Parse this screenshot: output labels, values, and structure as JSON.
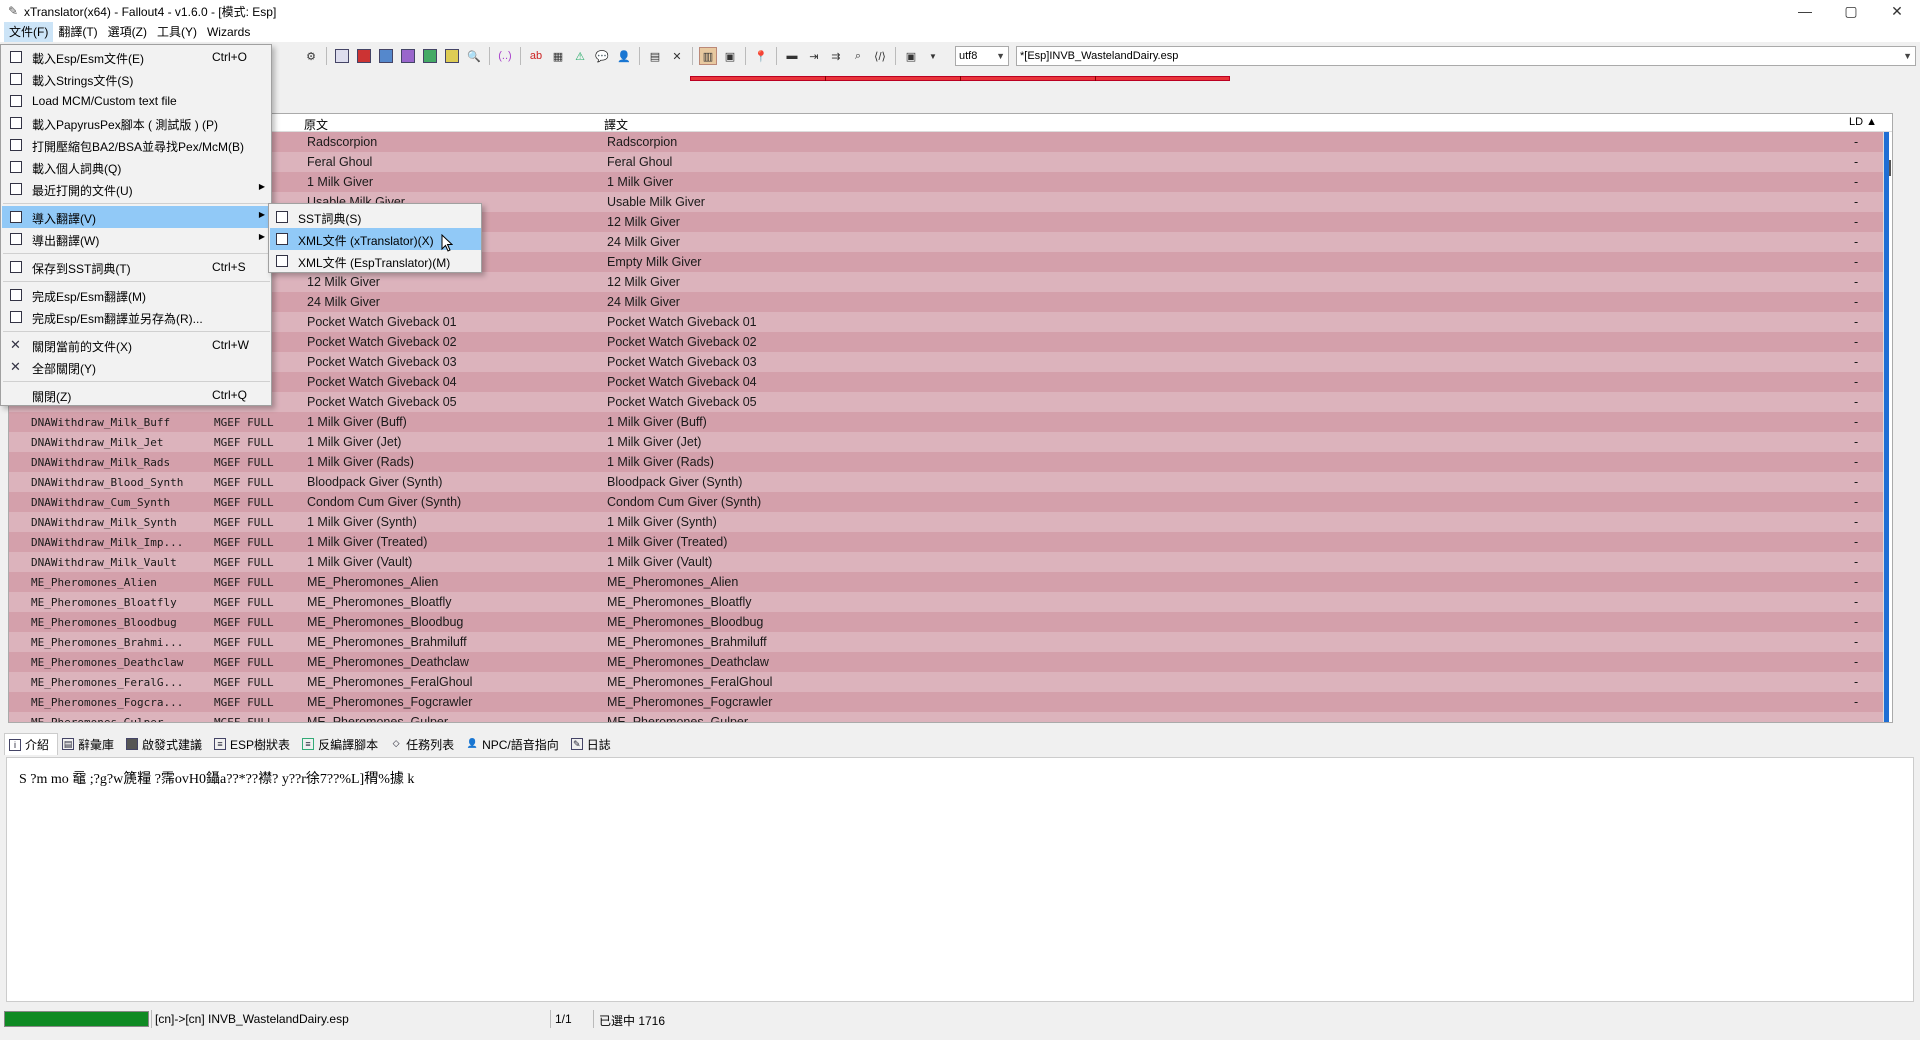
{
  "window": {
    "title": "xTranslator(x64) - Fallout4 - v1.6.0 - [模式: Esp]",
    "controls": [
      "—",
      "▢",
      "✕"
    ]
  },
  "menubar": [
    "文件(F)",
    "翻譯(T)",
    "選項(Z)",
    "工具(Y)",
    "Wizards"
  ],
  "toolbar": {
    "encoding": "utf8",
    "file": "*[Esp]INVB_WastelandDairy.esp"
  },
  "list": {
    "headers": {
      "source": "原文",
      "translation": "譯文",
      "ld": "LD ▲"
    },
    "rows": [
      {
        "id": "",
        "type": "",
        "src": "Radscorpion",
        "tr": "Radscorpion",
        "ld": "-"
      },
      {
        "id": "",
        "type": "",
        "src": "Feral Ghoul",
        "tr": "Feral Ghoul",
        "ld": "-"
      },
      {
        "id": "",
        "type": "",
        "src": "1 Milk Giver",
        "tr": "1 Milk Giver",
        "ld": "-"
      },
      {
        "id": "",
        "type": "",
        "src": "Usable Milk Giver",
        "tr": "Usable Milk Giver",
        "ld": "-"
      },
      {
        "id": "",
        "type": "",
        "src": "",
        "tr": "12 Milk Giver",
        "ld": "-"
      },
      {
        "id": "",
        "type": "",
        "src": "",
        "tr": "24 Milk Giver",
        "ld": "-"
      },
      {
        "id": "",
        "type": "",
        "src": "",
        "tr": "Empty Milk Giver",
        "ld": "-"
      },
      {
        "id": "",
        "type": "",
        "src": "12 Milk Giver",
        "tr": "12 Milk Giver",
        "ld": "-"
      },
      {
        "id": "",
        "type": "",
        "src": "24 Milk Giver",
        "tr": "24 Milk Giver",
        "ld": "-"
      },
      {
        "id": "",
        "type": "",
        "src": "Pocket Watch Giveback 01",
        "tr": "Pocket Watch Giveback 01",
        "ld": "-"
      },
      {
        "id": "",
        "type": "",
        "src": "Pocket Watch Giveback 02",
        "tr": "Pocket Watch Giveback 02",
        "ld": "-"
      },
      {
        "id": "",
        "type": "",
        "src": "Pocket Watch Giveback 03",
        "tr": "Pocket Watch Giveback 03",
        "ld": "-"
      },
      {
        "id": "",
        "type": "",
        "src": "Pocket Watch Giveback 04",
        "tr": "Pocket Watch Giveback 04",
        "ld": "-"
      },
      {
        "id": "",
        "type": "",
        "src": "Pocket Watch Giveback 05",
        "tr": "Pocket Watch Giveback 05",
        "ld": "-"
      },
      {
        "id": "DNAWithdraw_Milk_Buff",
        "type": "MGEF FULL",
        "src": "1 Milk Giver (Buff)",
        "tr": "1 Milk Giver (Buff)",
        "ld": "-"
      },
      {
        "id": "DNAWithdraw_Milk_Jet",
        "type": "MGEF FULL",
        "src": "1 Milk Giver (Jet)",
        "tr": "1 Milk Giver (Jet)",
        "ld": "-"
      },
      {
        "id": "DNAWithdraw_Milk_Rads",
        "type": "MGEF FULL",
        "src": "1 Milk Giver (Rads)",
        "tr": "1 Milk Giver (Rads)",
        "ld": "-"
      },
      {
        "id": "DNAWithdraw_Blood_Synth",
        "type": "MGEF FULL",
        "src": "Bloodpack Giver (Synth)",
        "tr": "Bloodpack Giver (Synth)",
        "ld": "-"
      },
      {
        "id": "DNAWithdraw_Cum_Synth",
        "type": "MGEF FULL",
        "src": "Condom Cum Giver (Synth)",
        "tr": "Condom Cum Giver (Synth)",
        "ld": "-"
      },
      {
        "id": "DNAWithdraw_Milk_Synth",
        "type": "MGEF FULL",
        "src": "1 Milk Giver (Synth)",
        "tr": "1 Milk Giver (Synth)",
        "ld": "-"
      },
      {
        "id": "DNAWithdraw_Milk_Imp...",
        "type": "MGEF FULL",
        "src": "1 Milk Giver (Treated)",
        "tr": "1 Milk Giver (Treated)",
        "ld": "-"
      },
      {
        "id": "DNAWithdraw_Milk_Vault",
        "type": "MGEF FULL",
        "src": "1 Milk Giver (Vault)",
        "tr": "1 Milk Giver (Vault)",
        "ld": "-"
      },
      {
        "id": "ME_Pheromones_Alien",
        "type": "MGEF FULL",
        "src": "ME_Pheromones_Alien",
        "tr": "ME_Pheromones_Alien",
        "ld": "-"
      },
      {
        "id": "ME_Pheromones_Bloatfly",
        "type": "MGEF FULL",
        "src": "ME_Pheromones_Bloatfly",
        "tr": "ME_Pheromones_Bloatfly",
        "ld": "-"
      },
      {
        "id": "ME_Pheromones_Bloodbug",
        "type": "MGEF FULL",
        "src": "ME_Pheromones_Bloodbug",
        "tr": "ME_Pheromones_Bloodbug",
        "ld": "-"
      },
      {
        "id": "ME_Pheromones_Brahmi...",
        "type": "MGEF FULL",
        "src": "ME_Pheromones_Brahmiluff",
        "tr": "ME_Pheromones_Brahmiluff",
        "ld": "-"
      },
      {
        "id": "ME_Pheromones_Deathclaw",
        "type": "MGEF FULL",
        "src": "ME_Pheromones_Deathclaw",
        "tr": "ME_Pheromones_Deathclaw",
        "ld": "-"
      },
      {
        "id": "ME_Pheromones_FeralG...",
        "type": "MGEF FULL",
        "src": "ME_Pheromones_FeralGhoul",
        "tr": "ME_Pheromones_FeralGhoul",
        "ld": "-"
      },
      {
        "id": "ME_Pheromones_Fogcra...",
        "type": "MGEF FULL",
        "src": "ME_Pheromones_Fogcrawler",
        "tr": "ME_Pheromones_Fogcrawler",
        "ld": "-"
      },
      {
        "id": "ME_Pheromones_Gulper",
        "type": "MGEF FULL",
        "src": "ME_Pheromones_Gulper",
        "tr": "ME_Pheromones_Gulper",
        "ld": "-"
      }
    ]
  },
  "tabs": [
    "介紹",
    "辭彙庫",
    "啟發式建議",
    "ESP樹狀表",
    "反編譯腳本",
    "任務列表",
    "NPC/語音指向",
    "日誌"
  ],
  "detail_text": "S ?m   mo   黿   ;?g?w篪糧 ?霈ovH0鑷a??*??襟?      y??r徐7??%L]稩%據   k",
  "status": {
    "progress": 1.0,
    "path": "[cn]->[cn] INVB_WastelandDairy.esp",
    "page": "1/1",
    "selected": "已選中 1716"
  },
  "file_menu": [
    {
      "label": "載入Esp/Esm文件(E)",
      "key": "Ctrl+O",
      "icon": "open-file-icon"
    },
    {
      "label": "載入Strings文件(S)",
      "key": "",
      "icon": "strings-file-icon"
    },
    {
      "label": "Load MCM/Custom text file",
      "key": "",
      "icon": "text-file-icon"
    },
    {
      "label": "載入PapyrusPex腳本 ( 測試版 ) (P)",
      "key": "",
      "icon": "script-file-icon"
    },
    {
      "label": "打開壓縮包BA2/BSA並尋找Pex/McM(B)",
      "key": "",
      "icon": "archive-icon"
    },
    {
      "label": "載入個人詞典(Q)",
      "key": "",
      "icon": "dictionary-icon"
    },
    {
      "label": "最近打開的文件(U)",
      "key": "",
      "icon": "recent-files-icon",
      "submenu": true
    },
    {
      "label": "導入翻譯(V)",
      "key": "",
      "icon": "import-icon",
      "submenu": true,
      "highlight": true
    },
    {
      "label": "導出翻譯(W)",
      "key": "",
      "icon": "export-icon",
      "submenu": true
    },
    {
      "label": "保存到SST詞典(T)",
      "key": "Ctrl+S",
      "icon": "save-icon"
    },
    {
      "label": "完成Esp/Esm翻譯(M)",
      "key": "",
      "icon": "finalize-icon"
    },
    {
      "label": "完成Esp/Esm翻譯並另存為(R)...",
      "key": "",
      "icon": "finalize-save-as-icon"
    },
    {
      "label": "關閉當前的文件(X)",
      "key": "Ctrl+W",
      "icon": "close-icon"
    },
    {
      "label": "全部關閉(Y)",
      "key": "",
      "icon": "close-all-icon"
    },
    {
      "label": "關閉(Z)",
      "key": "Ctrl+Q",
      "icon": ""
    }
  ],
  "import_submenu": [
    {
      "label": "SST詞典(S)",
      "highlight": false
    },
    {
      "label": "XML文件 (xTranslator)(X)",
      "highlight": true
    },
    {
      "label": "XML文件 (EspTranslator)(M)",
      "highlight": false
    }
  ]
}
